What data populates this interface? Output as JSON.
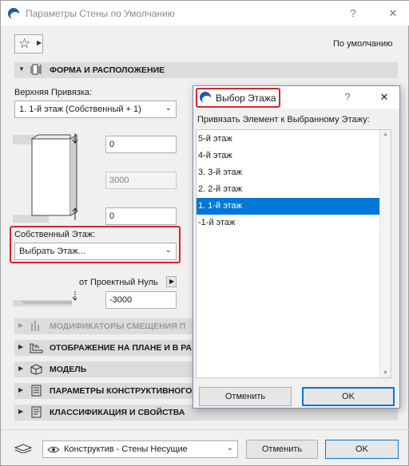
{
  "window": {
    "title": "Параметры Стены по Умолчанию",
    "help": "?",
    "close": "✕",
    "default_label": "По умолчанию"
  },
  "sections": {
    "shape": "ФОРМА И РАСПОЛОЖЕНИЕ",
    "modifiers": "МОДИФИКАТОРЫ СМЕЩЕНИЯ П",
    "plan": "ОТОБРАЖЕНИЕ НА ПЛАНЕ И В РА",
    "model": "МОДЕЛЬ",
    "structural": "ПАРАМЕТРЫ КОНСТРУКТИВНОГО",
    "classification": "КЛАССИФИКАЦИЯ И СВОЙСТВА"
  },
  "shape": {
    "top_link_label": "Верхняя Привязка:",
    "top_link_value": "1. 1-й этаж (Собственный + 1)",
    "top_offset": "0",
    "height": "3000",
    "bottom_offset": "0",
    "home_story_label": "Собственный Этаж:",
    "home_story_value": "Выбрать Этаж...",
    "from_label": "от Проектный Нуль",
    "base_elevation": "-3000"
  },
  "footer": {
    "layer": "Конструктив - Стены Несущие",
    "cancel": "Отменить",
    "ok": "OK"
  },
  "floor_dialog": {
    "title": "Выбор Этажа",
    "help": "?",
    "close": "✕",
    "prompt": "Привязать Элемент к Выбранному Этажу:",
    "stories": [
      "5-й этаж",
      "4-й этаж",
      "3. 3-й этаж",
      "2. 2-й этаж",
      "1. 1-й этаж",
      "-1-й этаж"
    ],
    "selected_index": 4,
    "cancel": "Отменить",
    "ok": "OK"
  },
  "colors": {
    "accent": "#0078d7",
    "highlight_box": "#e0212a",
    "section_bg": "#dcdcdc"
  }
}
